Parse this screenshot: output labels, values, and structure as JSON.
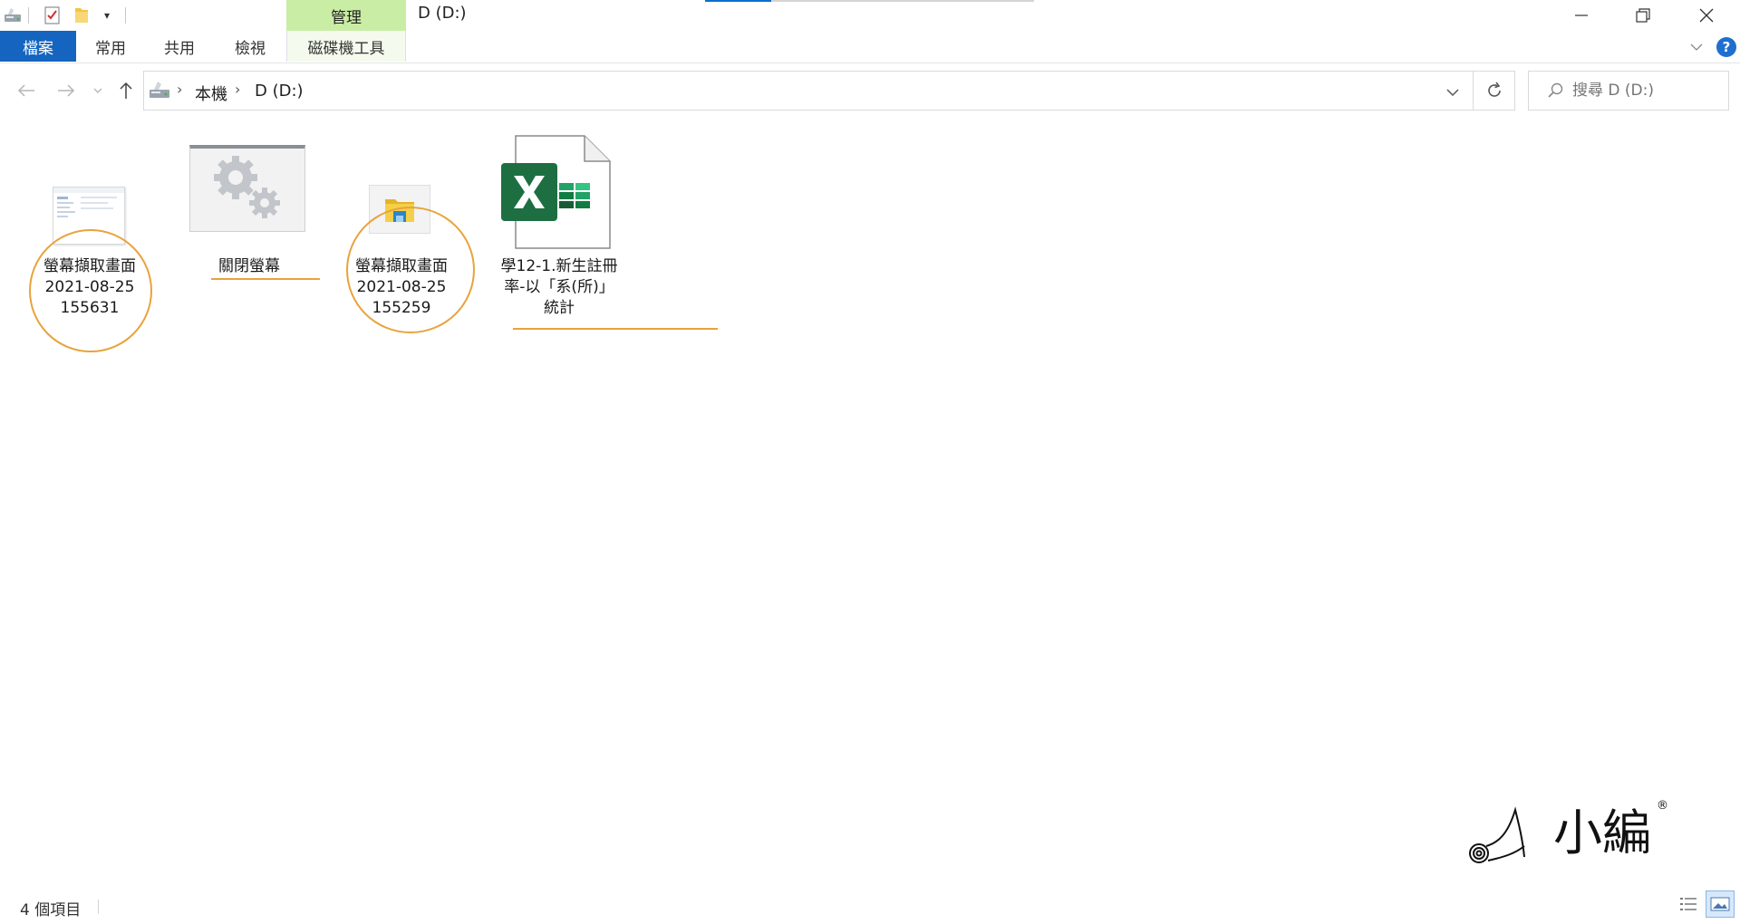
{
  "window": {
    "title": "D (D:)",
    "context_group": "管理"
  },
  "ribbon": {
    "tabs": [
      {
        "label": "檔案"
      },
      {
        "label": "常用"
      },
      {
        "label": "共用"
      },
      {
        "label": "檢視"
      },
      {
        "label": "磁碟機工具"
      }
    ],
    "help": "?"
  },
  "address": {
    "breadcrumbs": [
      "本機",
      "D (D:)"
    ]
  },
  "search": {
    "placeholder": "搜尋 D (D:)"
  },
  "items": [
    {
      "name_lines": [
        "螢幕擷取畫面",
        "2021-08-25",
        "155631"
      ],
      "icon": "screenshot-thumbnail"
    },
    {
      "name_lines": [
        "關閉螢幕"
      ],
      "icon": "gears-thumbnail"
    },
    {
      "name_lines": [
        "螢幕擷取畫面",
        "2021-08-25",
        "155259"
      ],
      "icon": "screenshot-thumbnail"
    },
    {
      "name_lines": [
        "學12-1.新生註冊",
        "率-以「系(所)」",
        "統計"
      ],
      "icon": "excel-file-icon"
    }
  ],
  "watermark": {
    "text": "小編",
    "mark": "®"
  },
  "status": {
    "item_count": "4 個項目"
  },
  "colors": {
    "file_tab": "#1565c0",
    "context_group": "#c9eda5",
    "highlight": "#e8a33c",
    "excel_green": "#1d6f42"
  }
}
